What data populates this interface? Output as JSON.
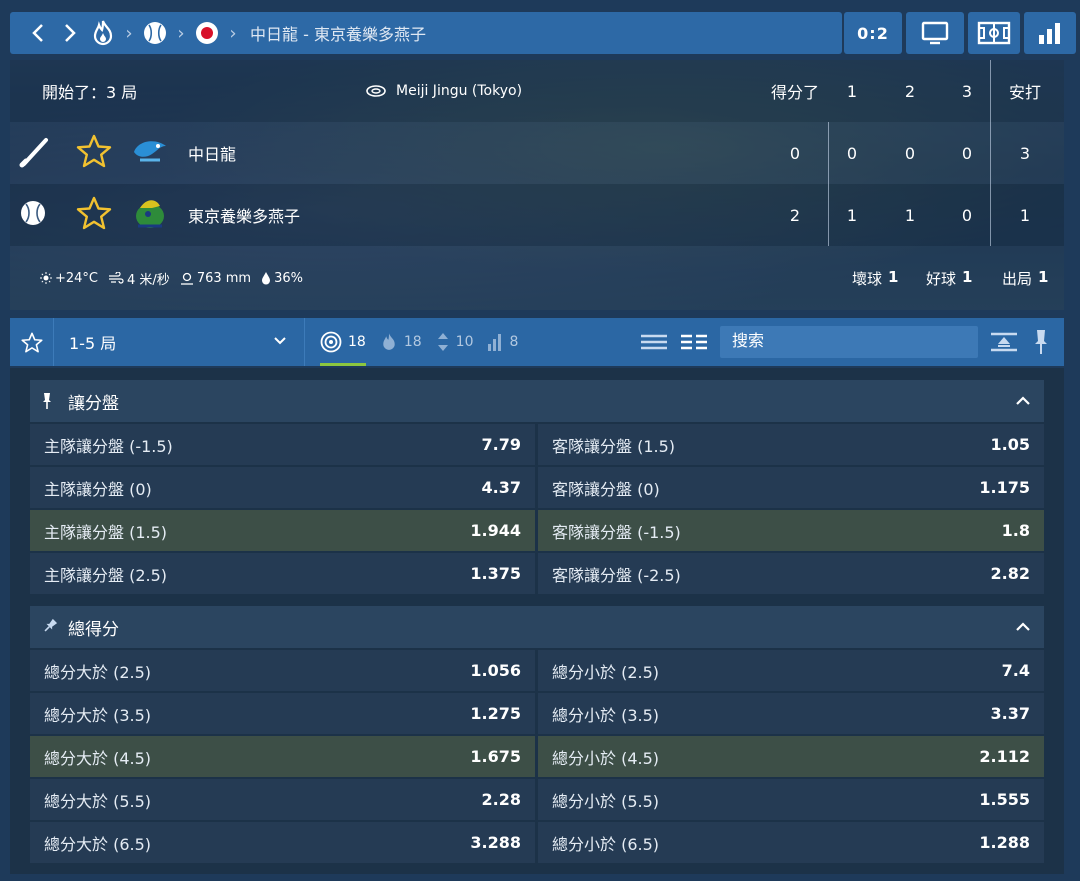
{
  "breadcrumb": {
    "match_title": "中日龍 - 東京養樂多燕子"
  },
  "header": {
    "score": "0:2"
  },
  "scoreboard": {
    "start_label": "開始了：3 局",
    "venue": "Meiji Jingu (Tokyo)",
    "columns": [
      "得分了",
      "1",
      "2",
      "3",
      "安打"
    ],
    "teams": [
      {
        "name": "中日龍",
        "role": "batting",
        "values": [
          "0",
          "0",
          "0",
          "0",
          "3"
        ]
      },
      {
        "name": "東京養樂多燕子",
        "role": "pitching",
        "values": [
          "2",
          "1",
          "1",
          "0",
          "1"
        ]
      }
    ],
    "weather": {
      "temperature": "+24°C",
      "wind": "4 米/秒",
      "pressure": "763 mm",
      "humidity": "36%"
    },
    "count": [
      {
        "label": "壞球",
        "value": "1"
      },
      {
        "label": "好球",
        "value": "1"
      },
      {
        "label": "出局",
        "value": "1"
      }
    ]
  },
  "filter": {
    "period_selected": "1-5 局",
    "counts": [
      "18",
      "18",
      "10",
      "8"
    ],
    "search_placeholder": "搜索"
  },
  "markets": [
    {
      "name": "讓分盤",
      "rows": [
        {
          "left_label": "主隊讓分盤 (-1.5)",
          "left_odds": "7.79",
          "right_label": "客隊讓分盤 (1.5)",
          "right_odds": "1.05",
          "highlight": false
        },
        {
          "left_label": "主隊讓分盤 (0)",
          "left_odds": "4.37",
          "right_label": "客隊讓分盤 (0)",
          "right_odds": "1.175",
          "highlight": false
        },
        {
          "left_label": "主隊讓分盤 (1.5)",
          "left_odds": "1.944",
          "right_label": "客隊讓分盤 (-1.5)",
          "right_odds": "1.8",
          "highlight": true
        },
        {
          "left_label": "主隊讓分盤 (2.5)",
          "left_odds": "1.375",
          "right_label": "客隊讓分盤 (-2.5)",
          "right_odds": "2.82",
          "highlight": false
        }
      ]
    },
    {
      "name": "總得分",
      "rows": [
        {
          "left_label": "總分大於 (2.5)",
          "left_odds": "1.056",
          "right_label": "總分小於 (2.5)",
          "right_odds": "7.4",
          "highlight": false
        },
        {
          "left_label": "總分大於 (3.5)",
          "left_odds": "1.275",
          "right_label": "總分小於 (3.5)",
          "right_odds": "3.37",
          "highlight": false
        },
        {
          "left_label": "總分大於 (4.5)",
          "left_odds": "1.675",
          "right_label": "總分小於 (4.5)",
          "right_odds": "2.112",
          "highlight": true
        },
        {
          "left_label": "總分大於 (5.5)",
          "left_odds": "2.28",
          "right_label": "總分小於 (5.5)",
          "right_odds": "1.555",
          "highlight": false
        },
        {
          "left_label": "總分大於 (6.5)",
          "left_odds": "3.288",
          "right_label": "總分小於 (6.5)",
          "right_odds": "1.288",
          "highlight": false
        }
      ]
    }
  ],
  "colors": {
    "accent": "#2d69a6",
    "star": "#f2c230",
    "highlight_row": "#3d4f47",
    "active_underline": "#8cc63f"
  }
}
